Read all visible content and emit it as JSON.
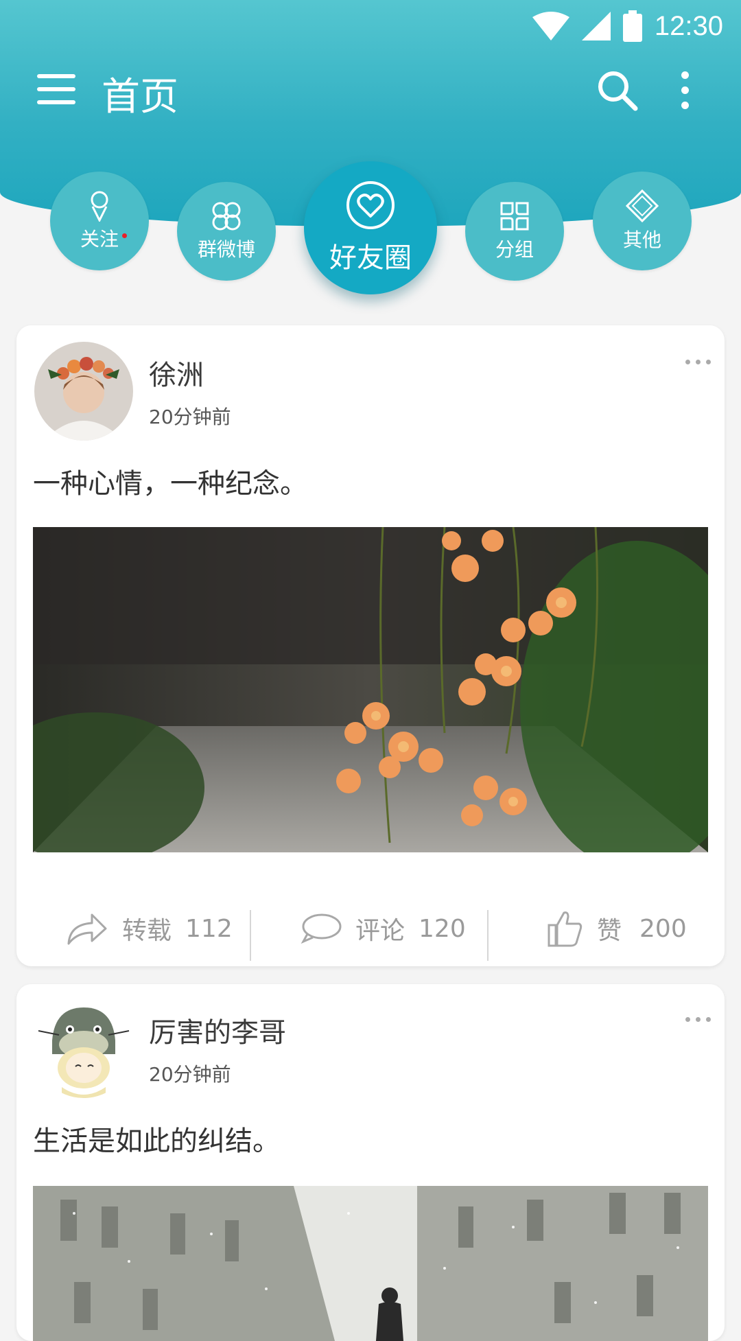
{
  "status_bar": {
    "time": "12:30"
  },
  "app_bar": {
    "title": "首页"
  },
  "tabs": [
    {
      "label": "关注",
      "icon": "follow-icon",
      "has_dot": true
    },
    {
      "label": "群微博",
      "icon": "group-weibo-icon"
    },
    {
      "label": "好友圈",
      "icon": "heart-icon",
      "active": true
    },
    {
      "label": "分组",
      "icon": "grid-icon"
    },
    {
      "label": "其他",
      "icon": "diamond-icon"
    }
  ],
  "posts": [
    {
      "author": "徐洲",
      "time": "20分钟前",
      "text": "一种心情，一种纪念。",
      "image": "orange flowers hanging over a blurred path",
      "actions": {
        "repost_label": "转载",
        "repost_count": "112",
        "comment_label": "评论",
        "comment_count": "120",
        "like_label": "赞",
        "like_count": "200"
      }
    },
    {
      "author": "厉害的李哥",
      "time": "20分钟前",
      "text": "生活是如此的纠结。",
      "image": "snowy city alley with a person"
    }
  ],
  "colors": {
    "header_top": "#55c6d0",
    "header_bottom": "#1ea6bd",
    "tab": "#4bbdc8",
    "tab_active": "#14a9c4",
    "notify_dot": "#e8202a"
  }
}
